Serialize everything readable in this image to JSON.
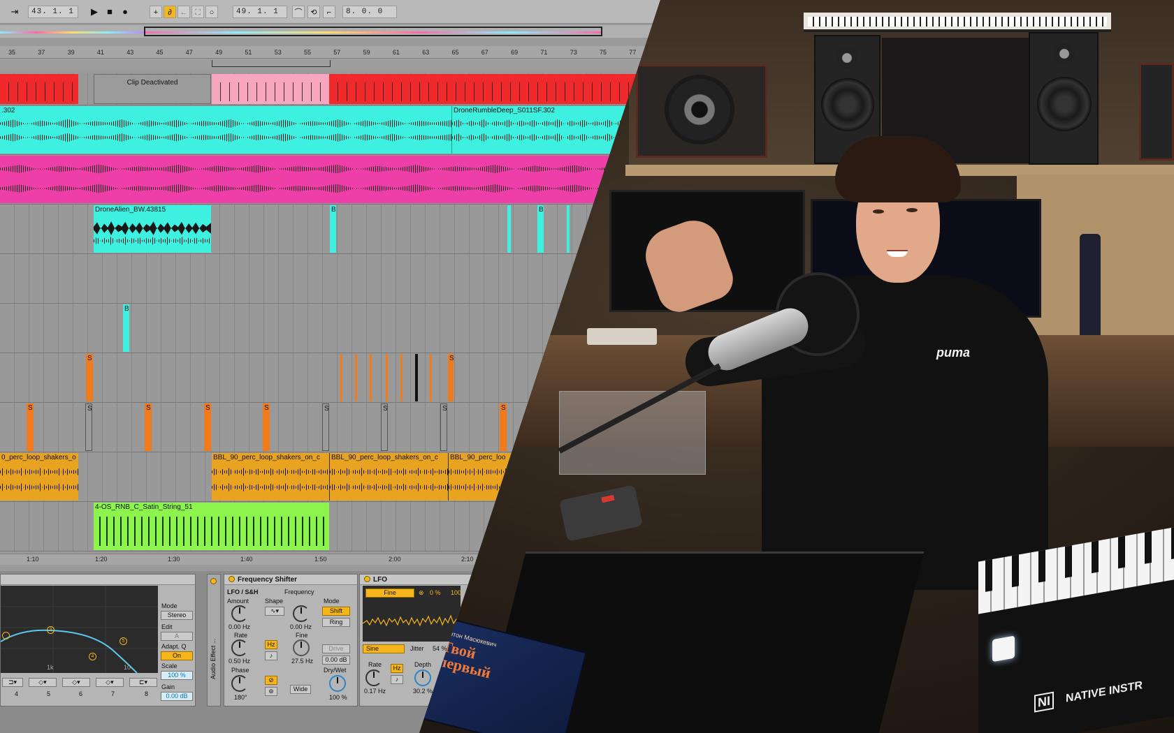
{
  "transport": {
    "arrangement_position": "43.  1.  1",
    "loop_start": "49.  1.  1",
    "loop_length": "8.  0.  0"
  },
  "ruler": [
    "35",
    "37",
    "39",
    "41",
    "43",
    "45",
    "47",
    "49",
    "51",
    "53",
    "55",
    "57",
    "59",
    "61",
    "63",
    "65",
    "67",
    "69",
    "71",
    "73",
    "75",
    "77"
  ],
  "clips": {
    "deactivated": "Clip Deactivated",
    "drone_left": ".302",
    "drone_right": "DroneRumbleDeep_S011SF.302",
    "drone_alien": "DroneAlien_BW.43815",
    "b_letter": "B",
    "s_letter": "S",
    "shaker_1": "0_perc_loop_shakers_o",
    "shaker_2": "BBL_90_perc_loop_shakers_on_c",
    "shaker_3": "BBL_90_perc_loop_shakers_on_c",
    "shaker_4": "BBL_90_perc_loo",
    "strings": "4-OS_RNB_C_Satin_String_51"
  },
  "time_ruler": [
    "1:10",
    "1:20",
    "1:30",
    "1:40",
    "1:50",
    "2:00",
    "2:10"
  ],
  "eq": {
    "mode_label": "Mode",
    "mode_value": "Stereo",
    "edit_label": "Edit",
    "edit_value": "A",
    "adapt_label": "Adapt. Q",
    "adapt_value": "On",
    "scale_label": "Scale",
    "scale_value": "100 %",
    "gain_label": "Gain",
    "gain_value": "0.00 dB",
    "freq_tick": "1k",
    "freq_tick2": "10",
    "band_nums": [
      "4",
      "5",
      "6",
      "7",
      "8"
    ],
    "dot_labels": [
      "3",
      "4",
      "5"
    ]
  },
  "side_strip_label": "Audio Effect ...",
  "freq_shifter": {
    "title": "Frequency Shifter",
    "lfo_section": "LFO / S&H",
    "amount_label": "Amount",
    "amount_value": "0.00 Hz",
    "shape_label": "Shape",
    "rate_label": "Rate",
    "rate_value": "0.50 Hz",
    "hz_btn": "Hz",
    "note_btn": "♪",
    "phase_label": "Phase",
    "phase_value": "180°",
    "frequency_label": "Frequency",
    "frequency_value": "0.00 Hz",
    "fine_label": "Fine",
    "fine_value": "27.5 Hz",
    "wide_btn": "Wide",
    "mode_label": "Mode",
    "shift_btn": "Shift",
    "ring_btn": "Ring",
    "drive_btn": "Drive",
    "drive_value": "0.00 dB",
    "drywet_label": "Dry/Wet",
    "drywet_value": "100 %"
  },
  "lfo": {
    "title": "LFO",
    "target": "Fine",
    "percent": "0 %",
    "hundred": "100",
    "wave": "Sine",
    "jitter_label": "Jitter",
    "jitter_value": "54 %",
    "rate_label": "Rate",
    "rate_value": "0.17 Hz",
    "hz_btn": "Hz",
    "note_btn": "♪",
    "depth_label": "Depth",
    "depth_value": "30.2 %"
  },
  "colors": {
    "red": "#f02a2a",
    "pink": "#f7a6c0",
    "cyan": "#3ef0df",
    "magenta": "#ee3fa8",
    "orange": "#f07b1d",
    "gold": "#e8a321",
    "green": "#8cf44c",
    "accent": "#f5b51b"
  },
  "photo": {
    "shirt_logo": "puma",
    "book_author": "Антон Масюкевич",
    "book_title": "Твой первый",
    "keyboard_brand": "NATIVE INSTR",
    "keyboard_logo": "NI"
  }
}
